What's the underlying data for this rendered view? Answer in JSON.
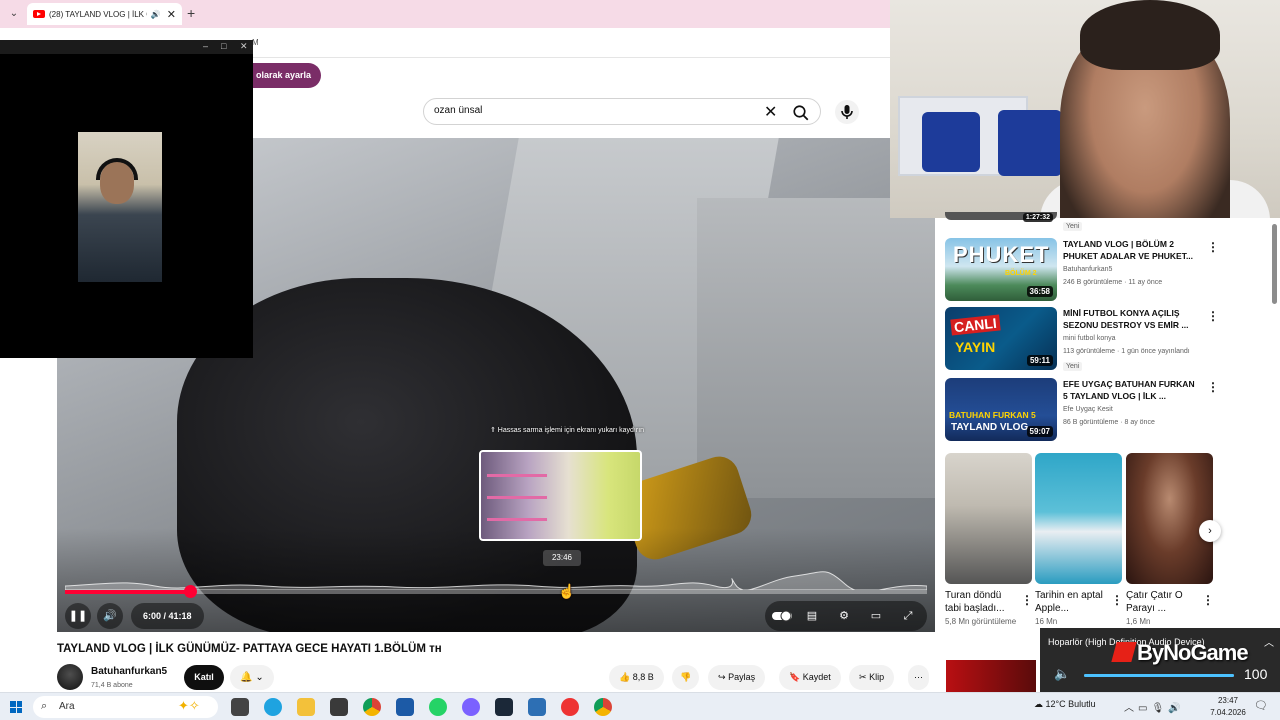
{
  "browser": {
    "tab_title": "(28) TAYLAND VLOG | İLK G",
    "new_tab": "+",
    "address_fragment": "M",
    "notice_button": "olarak ayarla"
  },
  "search": {
    "value": "ozan ünsal"
  },
  "player": {
    "scrub_hint": "⇑ Hassas sarma işlemi için ekranı yukarı kaydırın",
    "preview_time": "23:46",
    "current_time": "6:00",
    "duration": "41:18",
    "time_text": "6:00 / 41:18",
    "progress_fraction": 0.145,
    "hover_fraction": 0.575
  },
  "video": {
    "title": "TAYLAND VLOG | İLK GÜNÜMÜZ- PATTAYA GECE HAYATI 1.BÖLÜM 🇹🇭",
    "title_text": "TAYLAND VLOG | İLK GÜNÜMÜZ- PATTAYA GECE HAYATI 1.BÖLÜM ᴛʜ",
    "channel": "Batuhanfurkan5",
    "subscribers": "71,4 B abone",
    "join_label": "Katıl",
    "likes": "8,8 B",
    "share_label": "Paylaş",
    "save_label": "Kaydet",
    "clip_label": "Klip"
  },
  "sidebar": {
    "top_badge": "Yeni",
    "top_partial_duration": "1:27:32",
    "items": [
      {
        "title": "TAYLAND VLOG | BÖLÜM 2 PHUKET ADALAR VE PHUKET...",
        "channel": "Batuhanfurkan5",
        "meta": "246 B görüntüleme · 11 ay önce",
        "duration": "36:58",
        "thumb_text": "PHUKET",
        "thumb_sub": "BÖLÜM 2",
        "badge": ""
      },
      {
        "title": "MİNİ FUTBOL KONYA AÇILIŞ SEZONU DESTROY VS EMİR ...",
        "channel": "mini futbol konya",
        "meta": "113 görüntüleme · 1 gün önce yayınlandı",
        "duration": "59:11",
        "thumb_text": "CANLI",
        "thumb_sub": "YAYIN",
        "badge": "Yeni"
      },
      {
        "title": "EFE UYGAÇ BATUHAN FURKAN 5 TAYLAND VLOG | İLK ...",
        "channel": "Efe Uygaç Kesit",
        "meta": "86 B görüntüleme · 8 ay önce",
        "duration": "59:07",
        "thumb_text": "BATUHAN FURKAN 5",
        "thumb_sub": "TAYLAND VLOG",
        "badge": ""
      }
    ],
    "shorts": [
      {
        "title": "Turan döndü tabi başladı...",
        "views": "5,8 Mn görüntüleme"
      },
      {
        "title": "Tarihin en aptal Apple...",
        "views": "16 Mn"
      },
      {
        "title": "Çatır Çatır O Parayı ...",
        "views": "1,6 Mn"
      }
    ]
  },
  "volume": {
    "device": "Hoparlör (High Definition Audio Device)",
    "level": 100,
    "level_text": "100"
  },
  "watermark": "ByNoGame",
  "taskbar": {
    "search_label": "Ara",
    "weather": "12°C  Bulutlu",
    "time": "23:47",
    "date": "7.04.2026"
  },
  "colors": {
    "accent_red": "#ff0033",
    "notice_purple": "#7a2d67",
    "tab_strip": "#f6dbe7",
    "volume_blue": "#4cc2ff"
  }
}
